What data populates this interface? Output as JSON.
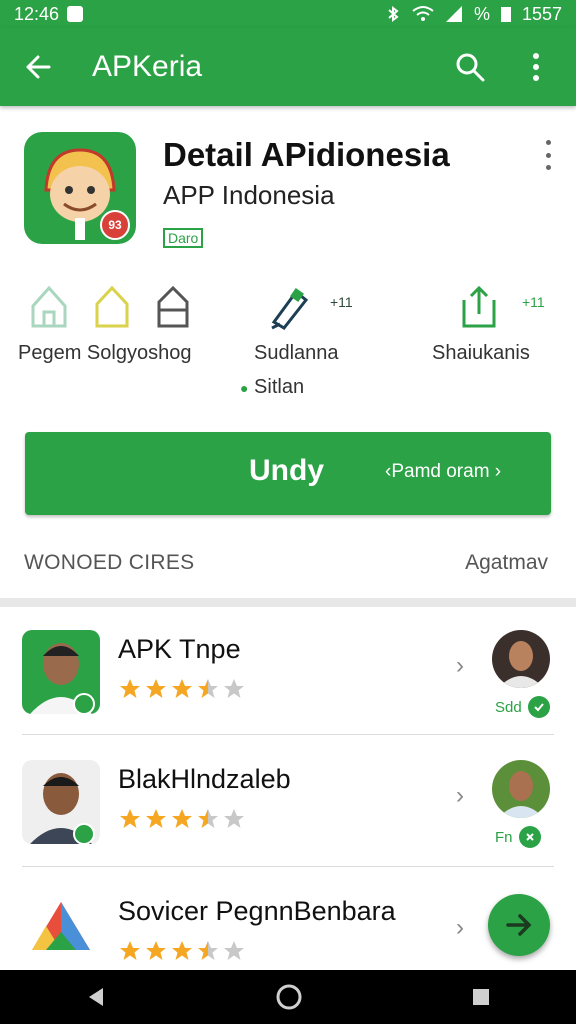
{
  "status_bar": {
    "time_left": "12:46",
    "battery_text": "%",
    "time_right": "1557"
  },
  "app_bar": {
    "title": "APKeria",
    "background": "#2ba245"
  },
  "app": {
    "title": "Detail APidionesia",
    "subtitle": "APP Indonesia",
    "tag": "Daro",
    "icon_badge": "93"
  },
  "actions": {
    "label_1": "Pegem Solgyoshog",
    "label_2": "Sudlanna",
    "label_2_sub": "Sitlan",
    "label_3": "Shaiukanis",
    "count_1": "+11",
    "count_2": "+11"
  },
  "primary_button": {
    "label": "Undy",
    "side_label": "Pamd oram"
  },
  "section": {
    "title": "WONOED CIRES",
    "action": "Agatmav"
  },
  "list": [
    {
      "title": "APK Tnpe",
      "rating": 3.5,
      "meta": "Sdd"
    },
    {
      "title": "BlakHlndzaleb",
      "rating": 3.5,
      "meta": "Fn"
    },
    {
      "title": "Sovicer PegnnBenbara",
      "rating": 3.5,
      "meta": ""
    }
  ],
  "colors": {
    "brand_green": "#2ba245",
    "star": "#f5a623",
    "star_empty": "#c8c8c8"
  }
}
